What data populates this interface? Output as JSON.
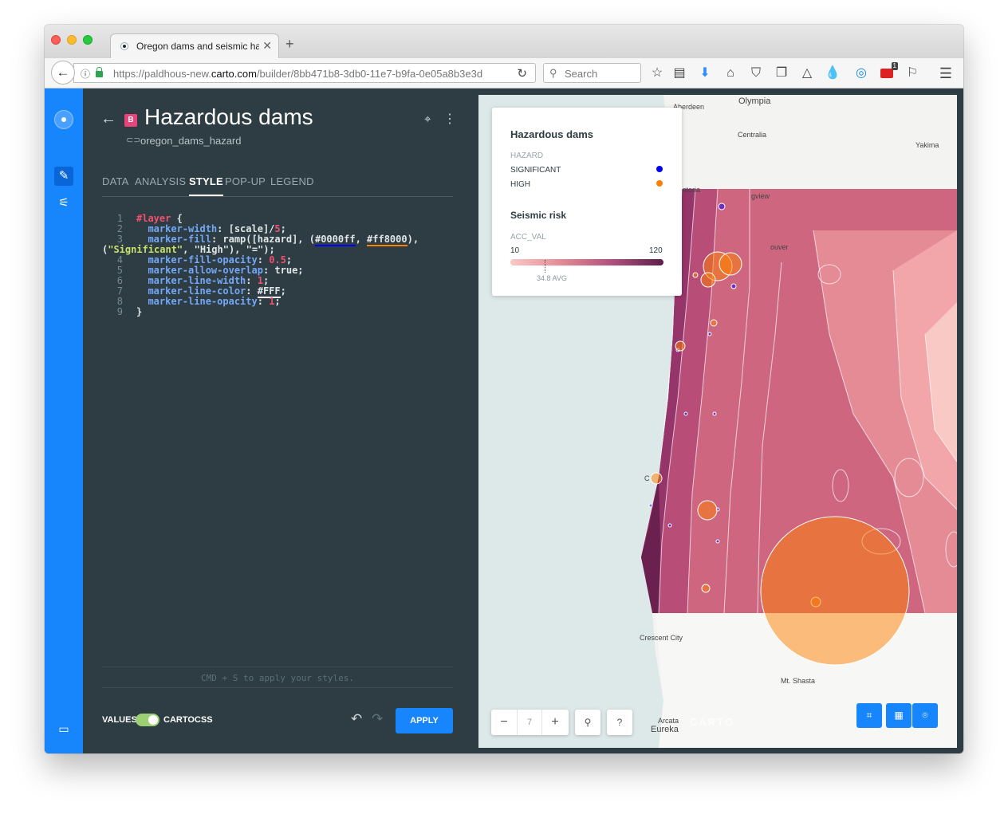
{
  "browser": {
    "tab_title": "Oregon dams and seismic haz",
    "url_prefix": "https://paldhous-new.",
    "url_host": "carto.com",
    "url_path": "/builder/8bb471b8-3db0-11e7-b9fa-0e05a8b3e3d",
    "search_placeholder": "Search",
    "notification_badge": "1"
  },
  "layer": {
    "badge": "B",
    "title": "Hazardous dams",
    "source": "oregon_dams_hazard"
  },
  "tabs": [
    "DATA",
    "ANALYSIS",
    "STYLE",
    "POP-UP",
    "LEGEND"
  ],
  "active_tab": "STYLE",
  "code": {
    "line_numbers": [
      "1",
      "2",
      "3",
      "",
      "4",
      "5",
      "6",
      "7",
      "8",
      "9"
    ],
    "selector": "#layer",
    "open_brace": " {",
    "close_brace": "}",
    "l2_prop": "marker-width",
    "l2_rest": ": [scale]/",
    "l2_num": "5",
    "l3_prop": "marker-fill",
    "l3_rest": ": ramp([hazard], (",
    "l3_color1": "#0000ff",
    "l3_sep": ", ",
    "l3_color2": "#ff8000",
    "l3_end": "),",
    "l3b_str1": "\"Significant\"",
    "l3b_mid": ", \"High\"), \"=\");",
    "l4_prop": "marker-fill-opacity",
    "l4_num": "0.5",
    "l5_prop": "marker-allow-overlap",
    "l5_val": ": true;",
    "l6_prop": "marker-line-width",
    "l6_num": "1",
    "l7_prop": "marker-line-color",
    "l7_color": "#FFF",
    "l8_prop": "marker-line-opacity",
    "l8_num": "1",
    "colon": ": ",
    "semi": ";"
  },
  "editor_footer": {
    "hint": "CMD + S to apply your styles.",
    "values_label": "VALUES",
    "cartocss_label": "CARTOCSS",
    "cartocss_on": true,
    "apply_label": "APPLY"
  },
  "legend": {
    "title": "Hazardous dams",
    "hazard_label": "HAZARD",
    "items": [
      {
        "label": "SIGNIFICANT",
        "color": "#0000ff"
      },
      {
        "label": "HIGH",
        "color": "#ff8000"
      }
    ],
    "seismic_title": "Seismic risk",
    "seismic_field": "ACC_VAL",
    "min": "10",
    "max": "120",
    "avg": "34.8 AVG"
  },
  "map": {
    "zoom_level": "7",
    "labels": {
      "aberdeen": "Aberdeen",
      "olympia": "Olympia",
      "centralia": "Centralia",
      "yakima": "Yakima",
      "astoria": "storia",
      "longview": "gview",
      "vancouver": "ouver",
      "crescent_city": "Crescent City",
      "mt_shasta": "Mt. Shasta",
      "arcata": "Arcata",
      "eureka": "Eureka",
      "coos_bay": "C"
    },
    "watermark": "CARTO"
  },
  "colors": {
    "accent": "#1785fb",
    "panel_bg": "#2e3c43",
    "significant": "#0000ff",
    "high": "#ff8000"
  }
}
